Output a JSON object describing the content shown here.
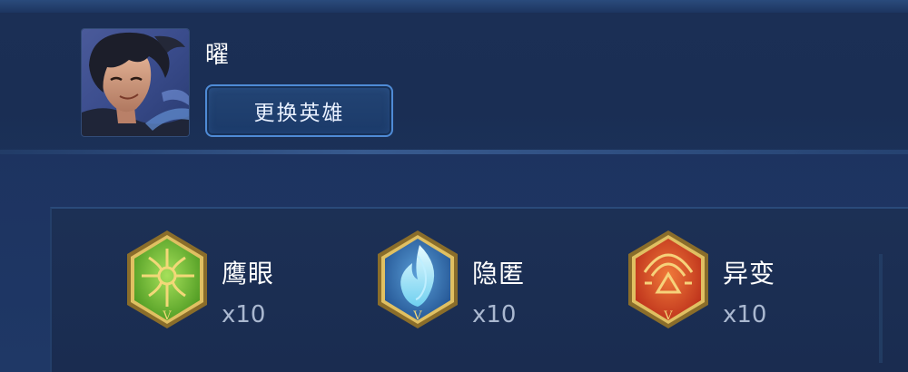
{
  "hero": {
    "name": "曜",
    "change_button_label": "更换英雄"
  },
  "buffs": [
    {
      "label": "鹰眼",
      "count": "x10",
      "icon": "eagle-eye-badge-icon",
      "color": "#7ec23c"
    },
    {
      "label": "隐匿",
      "count": "x10",
      "icon": "stealth-badge-icon",
      "color": "#7cc6e8"
    },
    {
      "label": "异变",
      "count": "x10",
      "icon": "mutation-badge-icon",
      "color": "#e2562a"
    }
  ],
  "colors": {
    "background": "#1c3158",
    "button_border": "#4f8bd6",
    "badge_gold": "#c9a64a"
  }
}
